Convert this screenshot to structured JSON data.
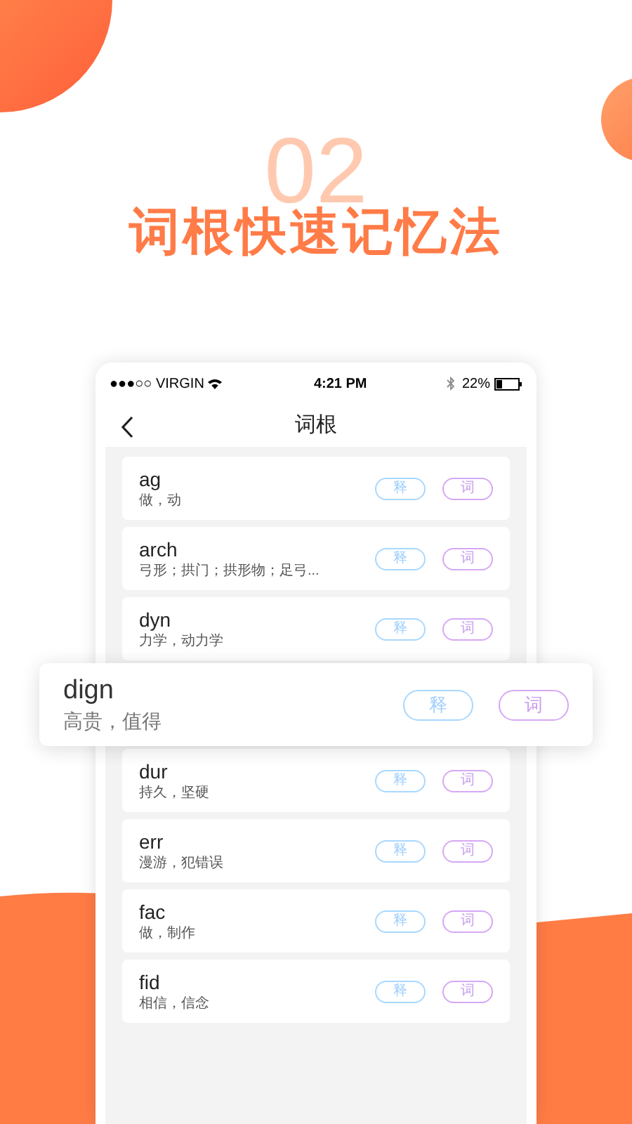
{
  "banner": {
    "number": "02",
    "title": "词根快速记忆法"
  },
  "status_bar": {
    "carrier": "●●●○○ VIRGIN",
    "time": "4:21 PM",
    "battery": "22%"
  },
  "nav": {
    "title": "词根"
  },
  "roots": [
    {
      "kind": "row",
      "root": "ag",
      "meaning": "做，动",
      "explain": "释",
      "words": "词"
    },
    {
      "kind": "row",
      "root": "arch",
      "meaning": "弓形；拱门；拱形物；足弓...",
      "explain": "释",
      "words": "词"
    },
    {
      "kind": "row",
      "root": "dyn",
      "meaning": "力学，动力学",
      "explain": "释",
      "words": "词"
    },
    {
      "kind": "popup",
      "root": "dign",
      "meaning": "高贵，值得",
      "explain": "释",
      "words": "词"
    },
    {
      "kind": "row",
      "root": "dur",
      "meaning": "持久，坚硬",
      "explain": "释",
      "words": "词"
    },
    {
      "kind": "row",
      "root": "err",
      "meaning": "漫游，犯错误",
      "explain": "释",
      "words": "词"
    },
    {
      "kind": "row",
      "root": "fac",
      "meaning": "做，制作",
      "explain": "释",
      "words": "词"
    },
    {
      "kind": "row",
      "root": "fid",
      "meaning": "相信，信念",
      "explain": "释",
      "words": "词"
    }
  ]
}
